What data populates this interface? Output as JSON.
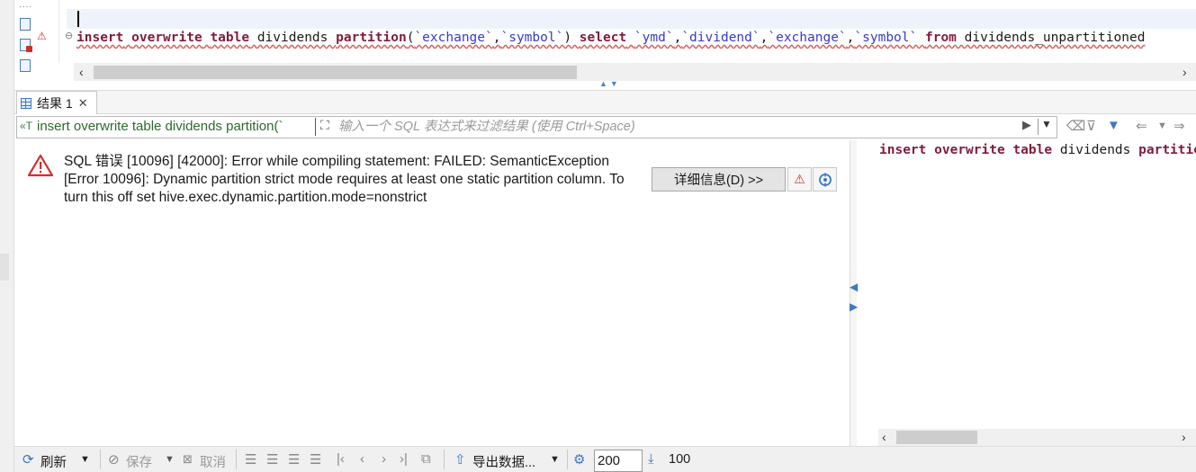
{
  "editor": {
    "ruler_dots": "....",
    "sql_tokens": [
      {
        "t": "insert",
        "k": "kw"
      },
      {
        "t": " ",
        "k": "tx"
      },
      {
        "t": "overwrite",
        "k": "kw"
      },
      {
        "t": " ",
        "k": "tx"
      },
      {
        "t": "table",
        "k": "kw"
      },
      {
        "t": " dividends ",
        "k": "tx"
      },
      {
        "t": "partition",
        "k": "kw"
      },
      {
        "t": "(",
        "k": "tx"
      },
      {
        "t": "`exchange`",
        "k": "str"
      },
      {
        "t": ",",
        "k": "tx"
      },
      {
        "t": "`symbol`",
        "k": "str"
      },
      {
        "t": ") ",
        "k": "tx"
      },
      {
        "t": "select",
        "k": "kw"
      },
      {
        "t": " ",
        "k": "tx"
      },
      {
        "t": "`ymd`",
        "k": "str"
      },
      {
        "t": ",",
        "k": "tx"
      },
      {
        "t": "`dividend`",
        "k": "str"
      },
      {
        "t": ",",
        "k": "tx"
      },
      {
        "t": "`exchange`",
        "k": "str"
      },
      {
        "t": ",",
        "k": "tx"
      },
      {
        "t": "`symbol`",
        "k": "str"
      },
      {
        "t": " ",
        "k": "tx"
      },
      {
        "t": "from",
        "k": "kw"
      },
      {
        "t": " dividends_unpartitioned",
        "k": "tx"
      }
    ]
  },
  "results_tab": {
    "label": "结果 1",
    "close": "✕"
  },
  "filter": {
    "query_text": "insert overwrite table dividends partition(`",
    "placeholder": "输入一个 SQL 表达式来过滤结果 (使用 Ctrl+Space)"
  },
  "error": {
    "message": "SQL 错误 [10096] [42000]: Error while compiling statement: FAILED: SemanticException [Error 10096]: Dynamic partition strict mode requires at least one static partition column. To turn this off set hive.exec.dynamic.partition.mode=nonstrict",
    "details_button": "详细信息(D) >>"
  },
  "sql_preview": {
    "tokens": [
      {
        "t": "insert",
        "k": "kw"
      },
      {
        "t": " ",
        "k": "tx"
      },
      {
        "t": "overwrite",
        "k": "kw"
      },
      {
        "t": " ",
        "k": "tx"
      },
      {
        "t": "table",
        "k": "kw"
      },
      {
        "t": " dividends ",
        "k": "tx"
      },
      {
        "t": "partition",
        "k": "kw"
      }
    ]
  },
  "bottom_toolbar": {
    "refresh": "刷新",
    "save": "保存",
    "cancel": "取消",
    "export": "导出数据...",
    "max_rows": "200",
    "fetched_rows": "100"
  },
  "colors": {
    "keyword": "#7f1d3a",
    "backtick_identifier": "#3a3ac8",
    "error_red": "#d42c2c",
    "accent_blue": "#3c78c8"
  }
}
